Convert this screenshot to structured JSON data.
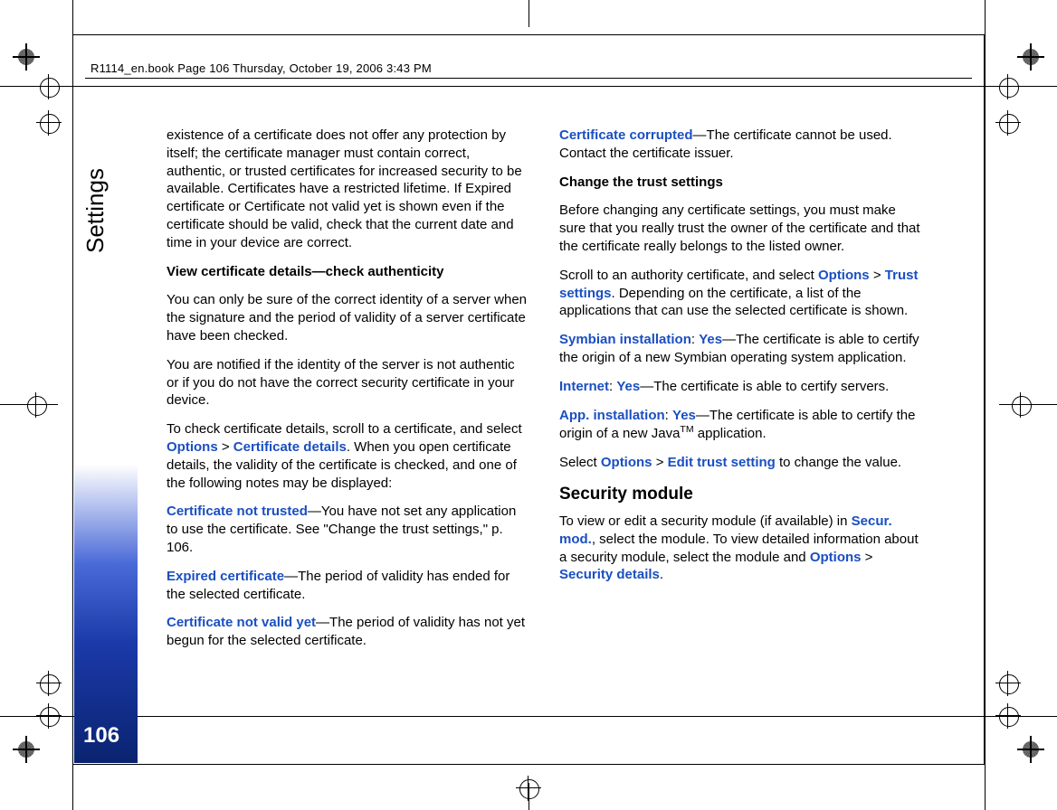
{
  "header": "R1114_en.book  Page 106  Thursday, October 19, 2006  3:43 PM",
  "section_label": "Settings",
  "page_number": "106",
  "colA": {
    "p1": "existence of a certificate does not offer any protection by itself; the certificate manager must contain correct, authentic, or trusted certificates for increased security to be available. Certificates have a restricted lifetime. If Expired certificate or Certificate not valid yet is shown even if the certificate should be valid, check that the current date and time in your device are correct.",
    "h1": "View certificate details—check authenticity",
    "p2": "You can only be sure of the correct identity of a server when the signature and the period of validity of a server certificate have been checked.",
    "p3": "You are notified if the identity of the server is not authentic or if you do not have the correct security certificate in your device.",
    "p4a": "To check certificate details, scroll to a certificate, and select ",
    "opt1": "Options",
    "gt": " > ",
    "certdetails": "Certificate details",
    "p4b": ". When you open certificate details, the validity of the certificate is checked, and one of the following notes may be displayed:",
    "cnt": "Certificate not trusted",
    "cnt_txt": "—You have not set any application to use the certificate. See \"Change the trust settings,\" p. 106.",
    "exp": "Expired certificate",
    "exp_txt": "—The period of validity has ended for the selected certificate.",
    "cnv": "Certificate not valid yet",
    "cnv_txt": "—The period of validity has not yet begun for the selected certificate."
  },
  "colB": {
    "cc": "Certificate corrupted",
    "cc_txt": "—The certificate cannot be used. Contact the certificate issuer.",
    "h2": "Change the trust settings",
    "p5": "Before changing any certificate settings, you must make sure that you really trust the owner of the certificate and that the certificate really belongs to the listed owner.",
    "p6a": "Scroll to an authority certificate, and select ",
    "opt2": "Options",
    "gt2": " > ",
    "trust": "Trust settings",
    "p6b": ". Depending on the certificate, a list of the applications that can use the selected certificate is shown.",
    "sym": "Symbian installation",
    "colon": ": ",
    "yes": "Yes",
    "sym_txt": "—The certificate is able to certify the origin of a new Symbian operating system application.",
    "int": "Internet",
    "int_txt": "—The certificate is able to certify servers.",
    "app": "App. installation",
    "app_txt": "—The certificate is able to certify the origin of a new Java",
    "tm": "TM",
    "app_txt2": " application.",
    "p7a": "Select ",
    "opt3": "Options",
    "gt3": " > ",
    "edit": "Edit trust setting",
    "p7b": " to change the value.",
    "h3": "Security module",
    "p8a": "To view or edit a security module (if available) in ",
    "secur": "Secur. mod.",
    "p8b": ", select the module. To view detailed information about a security module, select the module and ",
    "opt4": "Options",
    "gt4": " > ",
    "secd": "Security details",
    "dot": "."
  }
}
